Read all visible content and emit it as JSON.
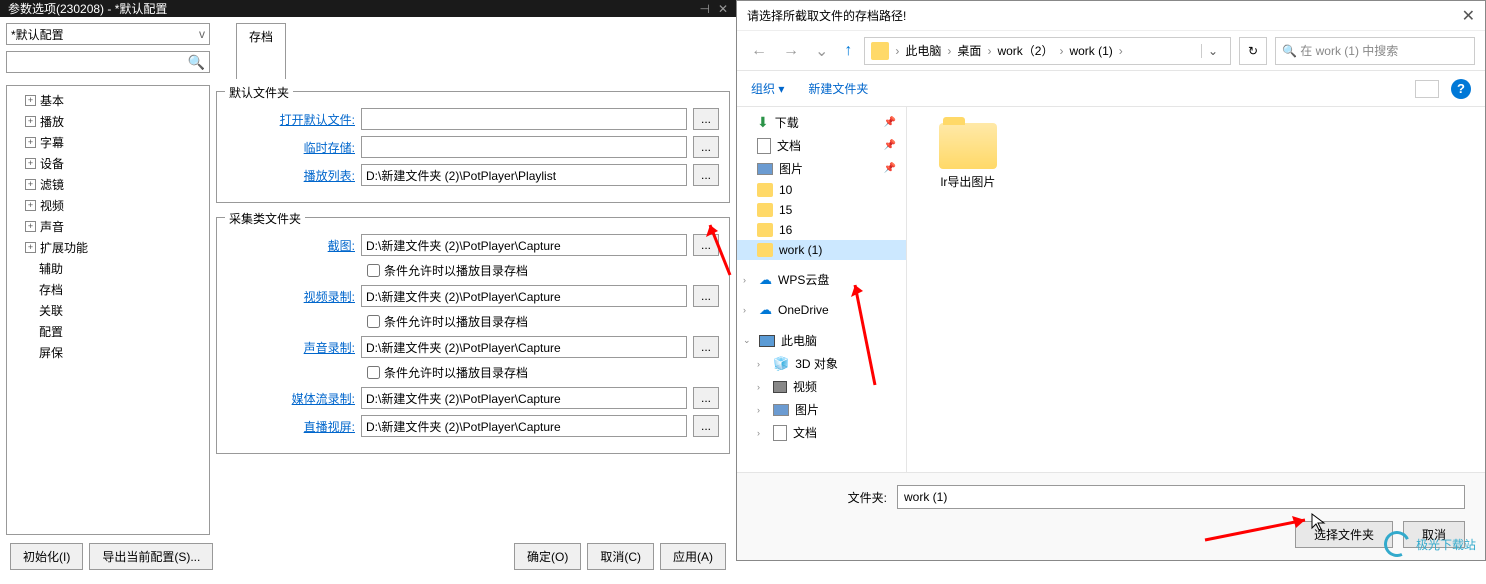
{
  "left": {
    "title": "参数选项(230208) - *默认配置",
    "config_selected": "*默认配置",
    "tab": "存档",
    "tree": {
      "basic": "基本",
      "playback": "播放",
      "subtitle": "字幕",
      "device": "设备",
      "filter": "滤镜",
      "video": "视频",
      "audio": "声音",
      "ext": "扩展功能",
      "assist": "辅助",
      "archive": "存档",
      "assoc": "关联",
      "config": "配置",
      "screensaver": "屏保"
    },
    "group1": {
      "title": "默认文件夹",
      "open_default": "打开默认文件:",
      "temp_save": "临时存储:",
      "playlist_label": "播放列表:",
      "playlist_value": "D:\\新建文件夹 (2)\\PotPlayer\\Playlist"
    },
    "group2": {
      "title": "采集类文件夹",
      "screenshot_label": "截图:",
      "screenshot_value": "D:\\新建文件夹 (2)\\PotPlayer\\Capture",
      "cb1": "条件允许时以播放目录存档",
      "videorec_label": "视频录制:",
      "videorec_value": "D:\\新建文件夹 (2)\\PotPlayer\\Capture",
      "cb2": "条件允许时以播放目录存档",
      "audiorec_label": "声音录制:",
      "audiorec_value": "D:\\新建文件夹 (2)\\PotPlayer\\Capture",
      "cb3": "条件允许时以播放目录存档",
      "streamrec_label": "媒体流录制:",
      "streamrec_value": "D:\\新建文件夹 (2)\\PotPlayer\\Capture",
      "livescreen_label": "直播视屏:",
      "livescreen_value": "D:\\新建文件夹 (2)\\PotPlayer\\Capture"
    },
    "buttons": {
      "init": "初始化(I)",
      "export": "导出当前配置(S)...",
      "ok": "确定(O)",
      "cancel": "取消(C)",
      "apply": "应用(A)"
    },
    "browse": "..."
  },
  "right": {
    "title": "请选择所截取文件的存档路径!",
    "breadcrumb": {
      "pc": "此电脑",
      "desktop": "桌面",
      "work2": "work（2）",
      "work1": "work (1)"
    },
    "search_placeholder": "在 work (1) 中搜索",
    "toolbar": {
      "organize": "组织 ▾",
      "new_folder": "新建文件夹"
    },
    "nav": {
      "downloads": "下载",
      "documents": "文档",
      "pictures": "图片",
      "f10": "10",
      "f15": "15",
      "f16": "16",
      "work1": "work (1)",
      "wps": "WPS云盘",
      "onedrive": "OneDrive",
      "thispc": "此电脑",
      "obj3d": "3D 对象",
      "videos": "视频",
      "pictures2": "图片",
      "docs2": "文档"
    },
    "content": {
      "folder1": "lr导出图片"
    },
    "footer": {
      "label": "文件夹:",
      "value": "work (1)",
      "select": "选择文件夹",
      "cancel": "取消"
    }
  },
  "watermark": "极光下载站"
}
